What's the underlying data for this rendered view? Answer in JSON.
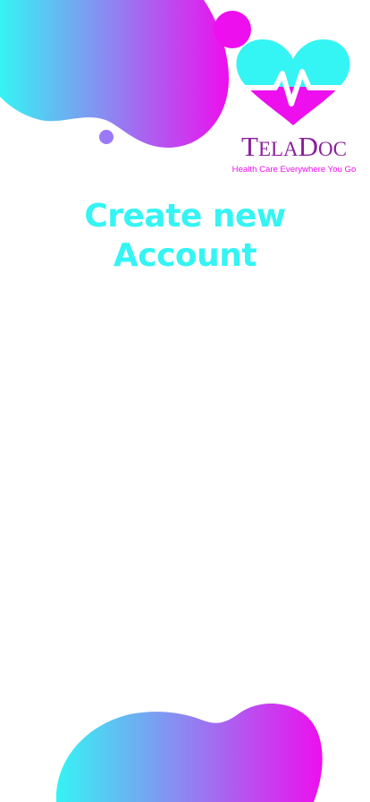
{
  "brand": {
    "name_initial_1": "T",
    "name_rest_1": "ELA",
    "name_initial_2": "D",
    "name_rest_2": "OC",
    "tagline": "Health Care Everywhere You Go"
  },
  "screen": {
    "title_line_1": "Create new",
    "title_line_2": "Account"
  },
  "colors": {
    "cyan": "#35F4F4",
    "magenta": "#ED0FEE",
    "violet": "#9B79F6",
    "brand_purple": "#8A1F9C",
    "background": "#FFFFFF"
  },
  "icons": {
    "logo_heart": "heart-pulse-icon"
  }
}
